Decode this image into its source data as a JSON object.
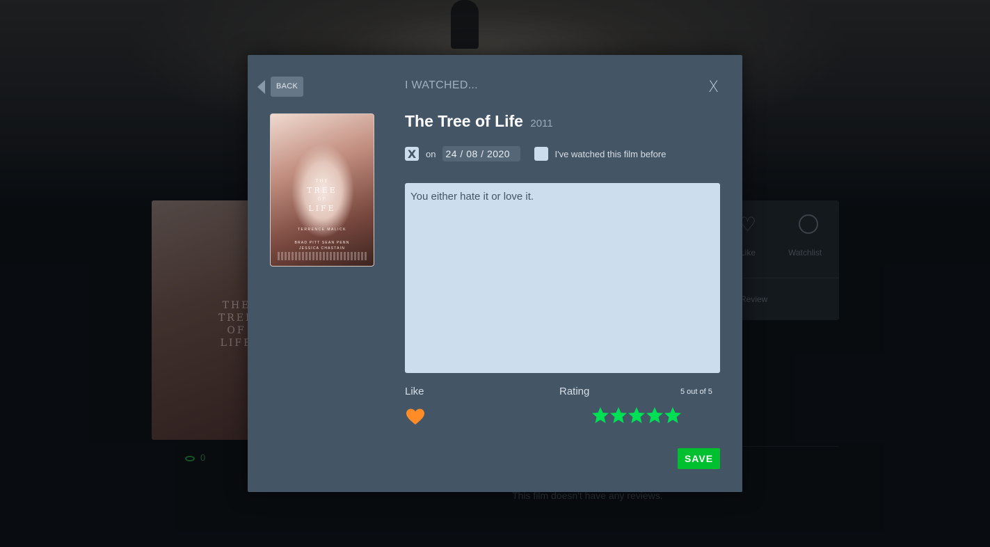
{
  "background": {
    "poster_text": [
      "THE",
      "TREE",
      "OF",
      "LIFE"
    ],
    "actions": {
      "like_label": "Like",
      "watchlist_label": "Watchlist",
      "review_label": "Review"
    },
    "views_count": "0",
    "no_reviews": "This film doesn't have any reviews."
  },
  "modal": {
    "back_label": "BACK",
    "heading": "I WATCHED...",
    "close_label": "X",
    "film": {
      "title": "The Tree of Life",
      "year": "2011"
    },
    "poster": {
      "title_small_top": "THE",
      "title_line1": "TREE",
      "title_small_mid": "OF",
      "title_line2": "LIFE",
      "credit": "TERRENCE MALICK",
      "cast_line1": "BRAD PITT      SEAN PENN",
      "cast_line2": "JESSICA CHASTAIN"
    },
    "date_checked_mark": "X",
    "on_label": "on",
    "date_value": "24 / 08 / 2020",
    "rewatch_label": "I've watched this film before",
    "review_text": "You either hate it or love it.",
    "like_label": "Like",
    "liked": true,
    "rating_label": "Rating",
    "rating_value_text": "5 out of 5",
    "rating": 5,
    "save_label": "SAVE",
    "colors": {
      "modal_bg": "#445566",
      "heart": "#ff8c26",
      "star": "#00e054",
      "save": "#00c030",
      "textarea_bg": "#ccddee"
    }
  }
}
